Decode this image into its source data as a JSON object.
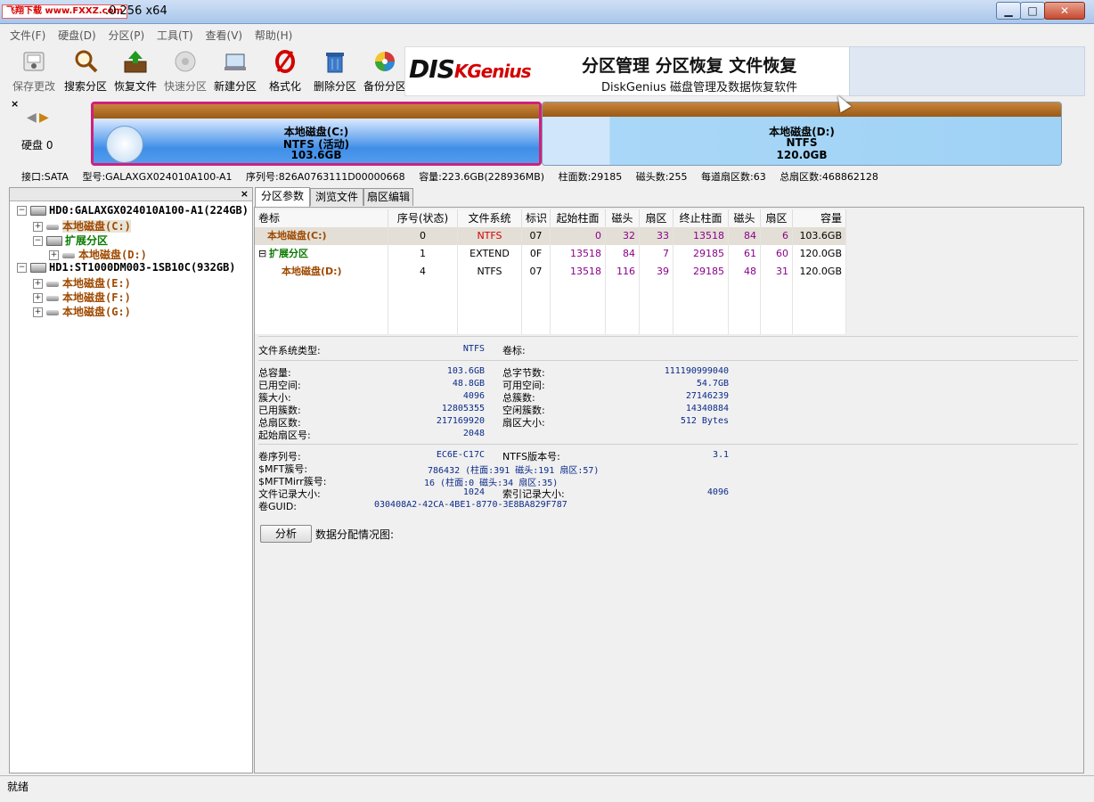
{
  "window": {
    "logo_text": "飞翔下载 www.FXXZ.com",
    "title": ".0.256 x64",
    "min": "▁",
    "max": "□",
    "close": "✕"
  },
  "menu": [
    "文件(F)",
    "硬盘(D)",
    "分区(P)",
    "工具(T)",
    "查看(V)",
    "帮助(H)"
  ],
  "toolbar": [
    {
      "label": "保存更改",
      "icon": "save-icon",
      "enabled": false
    },
    {
      "label": "搜索分区",
      "icon": "search-partition-icon",
      "enabled": true
    },
    {
      "label": "恢复文件",
      "icon": "recover-file-icon",
      "enabled": true
    },
    {
      "label": "快速分区",
      "icon": "quick-partition-icon",
      "enabled": false
    },
    {
      "label": "新建分区",
      "icon": "new-partition-icon",
      "enabled": true
    },
    {
      "label": "格式化",
      "icon": "format-icon",
      "enabled": true
    },
    {
      "label": "删除分区",
      "icon": "delete-partition-icon",
      "enabled": true
    },
    {
      "label": "备份分区",
      "icon": "backup-partition-icon",
      "enabled": true
    }
  ],
  "banner": {
    "brand_a": "DIS",
    "brand_b": "KGenius",
    "slogan": "分区管理 分区恢复 文件恢复",
    "sub": "DiskGenius 磁盘管理及数据恢复软件"
  },
  "diskbar": {
    "label": "硬盘 0",
    "partitions": [
      {
        "name": "本地磁盘(C:)",
        "fs": "NTFS (活动)",
        "size": "103.6GB"
      },
      {
        "name": "本地磁盘(D:)",
        "fs": "NTFS",
        "size": "120.0GB"
      }
    ],
    "info": [
      "接口:SATA",
      "型号:GALAXGX024010A100-A1",
      "序列号:826A0763111D00000668",
      "容量:223.6GB(228936MB)",
      "柱面数:29185",
      "磁头数:255",
      "每道扇区数:63",
      "总扇区数:468862128"
    ]
  },
  "tree": [
    {
      "level": 0,
      "exp": "−",
      "text": "HD0:GALAXGX024010A100-A1(224GB)",
      "style": "bold",
      "icon": "disk"
    },
    {
      "level": 1,
      "exp": "+",
      "text": "本地磁盘(C:)",
      "style": "brown",
      "icon": "part",
      "selected": true
    },
    {
      "level": 1,
      "exp": "−",
      "text": "扩展分区",
      "style": "green",
      "icon": "ext"
    },
    {
      "level": 2,
      "exp": "+",
      "text": "本地磁盘(D:)",
      "style": "brown",
      "icon": "part"
    },
    {
      "level": 0,
      "exp": "−",
      "text": "HD1:ST1000DM003-1SB10C(932GB)",
      "style": "bold",
      "icon": "disk"
    },
    {
      "level": 1,
      "exp": "+",
      "text": "本地磁盘(E:)",
      "style": "brown",
      "icon": "part"
    },
    {
      "level": 1,
      "exp": "+",
      "text": "本地磁盘(F:)",
      "style": "brown",
      "icon": "part"
    },
    {
      "level": 1,
      "exp": "+",
      "text": "本地磁盘(G:)",
      "style": "brown",
      "icon": "part"
    }
  ],
  "tabs": [
    "分区参数",
    "浏览文件",
    "扇区编辑"
  ],
  "table": {
    "headers": [
      "卷标",
      "序号(状态)",
      "文件系统",
      "标识",
      "起始柱面",
      "磁头",
      "扇区",
      "终止柱面",
      "磁头",
      "扇区",
      "容量"
    ],
    "rows": [
      {
        "label": "本地磁盘(C:)",
        "cells": [
          "0",
          "NTFS",
          "07",
          "0",
          "32",
          "33",
          "13518",
          "84",
          "6",
          "103.6GB"
        ]
      },
      {
        "label": "扩展分区",
        "cells": [
          "1",
          "EXTEND",
          "0F",
          "13518",
          "84",
          "7",
          "29185",
          "61",
          "60",
          "120.0GB"
        ]
      },
      {
        "label": "本地磁盘(D:)",
        "cells": [
          "4",
          "NTFS",
          "07",
          "13518",
          "116",
          "39",
          "29185",
          "48",
          "31",
          "120.0GB"
        ]
      }
    ]
  },
  "fsinfo": {
    "fs_type_label": "文件系统类型:",
    "fs_type": "NTFS",
    "volume_label": "卷标:",
    "left": [
      [
        "总容量:",
        "103.6GB"
      ],
      [
        "已用空间:",
        "48.8GB"
      ],
      [
        "簇大小:",
        "4096"
      ],
      [
        "已用簇数:",
        "12805355"
      ],
      [
        "总扇区数:",
        "217169920"
      ],
      [
        "起始扇区号:",
        "2048"
      ]
    ],
    "right": [
      [
        "总字节数:",
        "111190999040"
      ],
      [
        "可用空间:",
        "54.7GB"
      ],
      [
        "总簇数:",
        "27146239"
      ],
      [
        "空闲簇数:",
        "14340884"
      ],
      [
        "扇区大小:",
        "512 Bytes"
      ]
    ],
    "serial_label": "卷序列号:",
    "serial": "EC6E-C17C",
    "ntfs_ver_label": "NTFS版本号:",
    "ntfs_ver": "3.1",
    "mft_label": "$MFT簇号:",
    "mft": "786432 (柱面:391 磁头:191 扇区:57)",
    "mftmirr_label": "$MFTMirr簇号:",
    "mftmirr": "16 (柱面:0 磁头:34 扇区:35)",
    "filerec_label": "文件记录大小:",
    "filerec": "1024",
    "indexrec_label": "索引记录大小:",
    "indexrec": "4096",
    "guid_label": "卷GUID:",
    "guid": "030408A2-42CA-4BE1-8770-3E8BA829F787"
  },
  "analyze_label": "分析",
  "alloc_label": "数据分配情况图:",
  "status": "就绪"
}
